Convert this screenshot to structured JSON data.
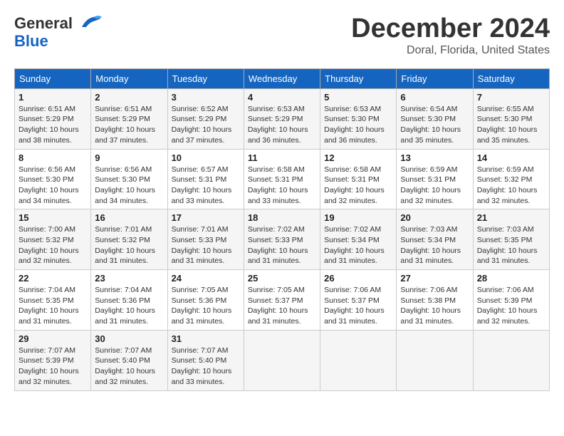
{
  "header": {
    "logo_line1": "General",
    "logo_line2": "Blue",
    "month": "December 2024",
    "location": "Doral, Florida, United States"
  },
  "weekdays": [
    "Sunday",
    "Monday",
    "Tuesday",
    "Wednesday",
    "Thursday",
    "Friday",
    "Saturday"
  ],
  "weeks": [
    [
      {
        "day": "1",
        "sunrise": "6:51 AM",
        "sunset": "5:29 PM",
        "daylight": "10 hours and 38 minutes."
      },
      {
        "day": "2",
        "sunrise": "6:51 AM",
        "sunset": "5:29 PM",
        "daylight": "10 hours and 37 minutes."
      },
      {
        "day": "3",
        "sunrise": "6:52 AM",
        "sunset": "5:29 PM",
        "daylight": "10 hours and 37 minutes."
      },
      {
        "day": "4",
        "sunrise": "6:53 AM",
        "sunset": "5:29 PM",
        "daylight": "10 hours and 36 minutes."
      },
      {
        "day": "5",
        "sunrise": "6:53 AM",
        "sunset": "5:30 PM",
        "daylight": "10 hours and 36 minutes."
      },
      {
        "day": "6",
        "sunrise": "6:54 AM",
        "sunset": "5:30 PM",
        "daylight": "10 hours and 35 minutes."
      },
      {
        "day": "7",
        "sunrise": "6:55 AM",
        "sunset": "5:30 PM",
        "daylight": "10 hours and 35 minutes."
      }
    ],
    [
      {
        "day": "8",
        "sunrise": "6:56 AM",
        "sunset": "5:30 PM",
        "daylight": "10 hours and 34 minutes."
      },
      {
        "day": "9",
        "sunrise": "6:56 AM",
        "sunset": "5:30 PM",
        "daylight": "10 hours and 34 minutes."
      },
      {
        "day": "10",
        "sunrise": "6:57 AM",
        "sunset": "5:31 PM",
        "daylight": "10 hours and 33 minutes."
      },
      {
        "day": "11",
        "sunrise": "6:58 AM",
        "sunset": "5:31 PM",
        "daylight": "10 hours and 33 minutes."
      },
      {
        "day": "12",
        "sunrise": "6:58 AM",
        "sunset": "5:31 PM",
        "daylight": "10 hours and 32 minutes."
      },
      {
        "day": "13",
        "sunrise": "6:59 AM",
        "sunset": "5:31 PM",
        "daylight": "10 hours and 32 minutes."
      },
      {
        "day": "14",
        "sunrise": "6:59 AM",
        "sunset": "5:32 PM",
        "daylight": "10 hours and 32 minutes."
      }
    ],
    [
      {
        "day": "15",
        "sunrise": "7:00 AM",
        "sunset": "5:32 PM",
        "daylight": "10 hours and 32 minutes."
      },
      {
        "day": "16",
        "sunrise": "7:01 AM",
        "sunset": "5:32 PM",
        "daylight": "10 hours and 31 minutes."
      },
      {
        "day": "17",
        "sunrise": "7:01 AM",
        "sunset": "5:33 PM",
        "daylight": "10 hours and 31 minutes."
      },
      {
        "day": "18",
        "sunrise": "7:02 AM",
        "sunset": "5:33 PM",
        "daylight": "10 hours and 31 minutes."
      },
      {
        "day": "19",
        "sunrise": "7:02 AM",
        "sunset": "5:34 PM",
        "daylight": "10 hours and 31 minutes."
      },
      {
        "day": "20",
        "sunrise": "7:03 AM",
        "sunset": "5:34 PM",
        "daylight": "10 hours and 31 minutes."
      },
      {
        "day": "21",
        "sunrise": "7:03 AM",
        "sunset": "5:35 PM",
        "daylight": "10 hours and 31 minutes."
      }
    ],
    [
      {
        "day": "22",
        "sunrise": "7:04 AM",
        "sunset": "5:35 PM",
        "daylight": "10 hours and 31 minutes."
      },
      {
        "day": "23",
        "sunrise": "7:04 AM",
        "sunset": "5:36 PM",
        "daylight": "10 hours and 31 minutes."
      },
      {
        "day": "24",
        "sunrise": "7:05 AM",
        "sunset": "5:36 PM",
        "daylight": "10 hours and 31 minutes."
      },
      {
        "day": "25",
        "sunrise": "7:05 AM",
        "sunset": "5:37 PM",
        "daylight": "10 hours and 31 minutes."
      },
      {
        "day": "26",
        "sunrise": "7:06 AM",
        "sunset": "5:37 PM",
        "daylight": "10 hours and 31 minutes."
      },
      {
        "day": "27",
        "sunrise": "7:06 AM",
        "sunset": "5:38 PM",
        "daylight": "10 hours and 31 minutes."
      },
      {
        "day": "28",
        "sunrise": "7:06 AM",
        "sunset": "5:39 PM",
        "daylight": "10 hours and 32 minutes."
      }
    ],
    [
      {
        "day": "29",
        "sunrise": "7:07 AM",
        "sunset": "5:39 PM",
        "daylight": "10 hours and 32 minutes."
      },
      {
        "day": "30",
        "sunrise": "7:07 AM",
        "sunset": "5:40 PM",
        "daylight": "10 hours and 32 minutes."
      },
      {
        "day": "31",
        "sunrise": "7:07 AM",
        "sunset": "5:40 PM",
        "daylight": "10 hours and 33 minutes."
      },
      null,
      null,
      null,
      null
    ]
  ],
  "labels": {
    "sunrise": "Sunrise:",
    "sunset": "Sunset:",
    "daylight": "Daylight:"
  }
}
